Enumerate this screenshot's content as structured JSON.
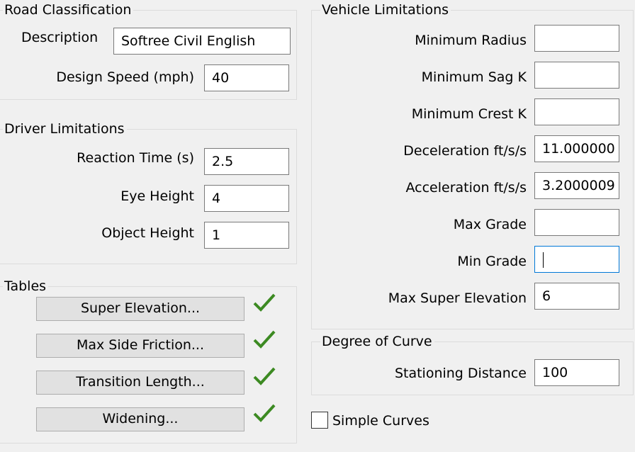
{
  "road_classification": {
    "legend": "Road Classification",
    "description_label": "Description",
    "description_value": "Softree Civil English",
    "design_speed_label": "Design Speed (mph)",
    "design_speed_value": "40"
  },
  "driver_limitations": {
    "legend": "Driver Limitations",
    "reaction_time_label": "Reaction Time (s)",
    "reaction_time_value": "2.5",
    "eye_height_label": "Eye Height",
    "eye_height_value": "4",
    "object_height_label": "Object Height",
    "object_height_value": "1"
  },
  "tables": {
    "legend": "Tables",
    "buttons": [
      {
        "label": "Super Elevation...",
        "status": "check-icon"
      },
      {
        "label": "Max Side Friction...",
        "status": "check-icon"
      },
      {
        "label": "Transition Length...",
        "status": "check-icon"
      },
      {
        "label": "Widening...",
        "status": "check-icon"
      }
    ],
    "check_color": "#3c8a22"
  },
  "vehicle_limitations": {
    "legend": "Vehicle Limitations",
    "fields": [
      {
        "label": "Minimum Radius",
        "value": ""
      },
      {
        "label": "Minimum Sag K",
        "value": ""
      },
      {
        "label": "Minimum Crest K",
        "value": ""
      },
      {
        "label": "Deceleration ft/s/s",
        "value": "11.000000"
      },
      {
        "label": "Acceleration ft/s/s",
        "value": "3.2000009"
      },
      {
        "label": "Max Grade",
        "value": ""
      },
      {
        "label": "Min Grade",
        "value": ""
      },
      {
        "label": "Max Super Elevation",
        "value": "6"
      }
    ]
  },
  "degree_of_curve": {
    "legend": "Degree of Curve",
    "stationing_label": "Stationing Distance",
    "stationing_value": "100"
  },
  "simple_curves": {
    "label": "Simple Curves",
    "checked": false
  },
  "colors": {
    "background": "#f0f0f0",
    "focus_border": "#0078d7"
  }
}
